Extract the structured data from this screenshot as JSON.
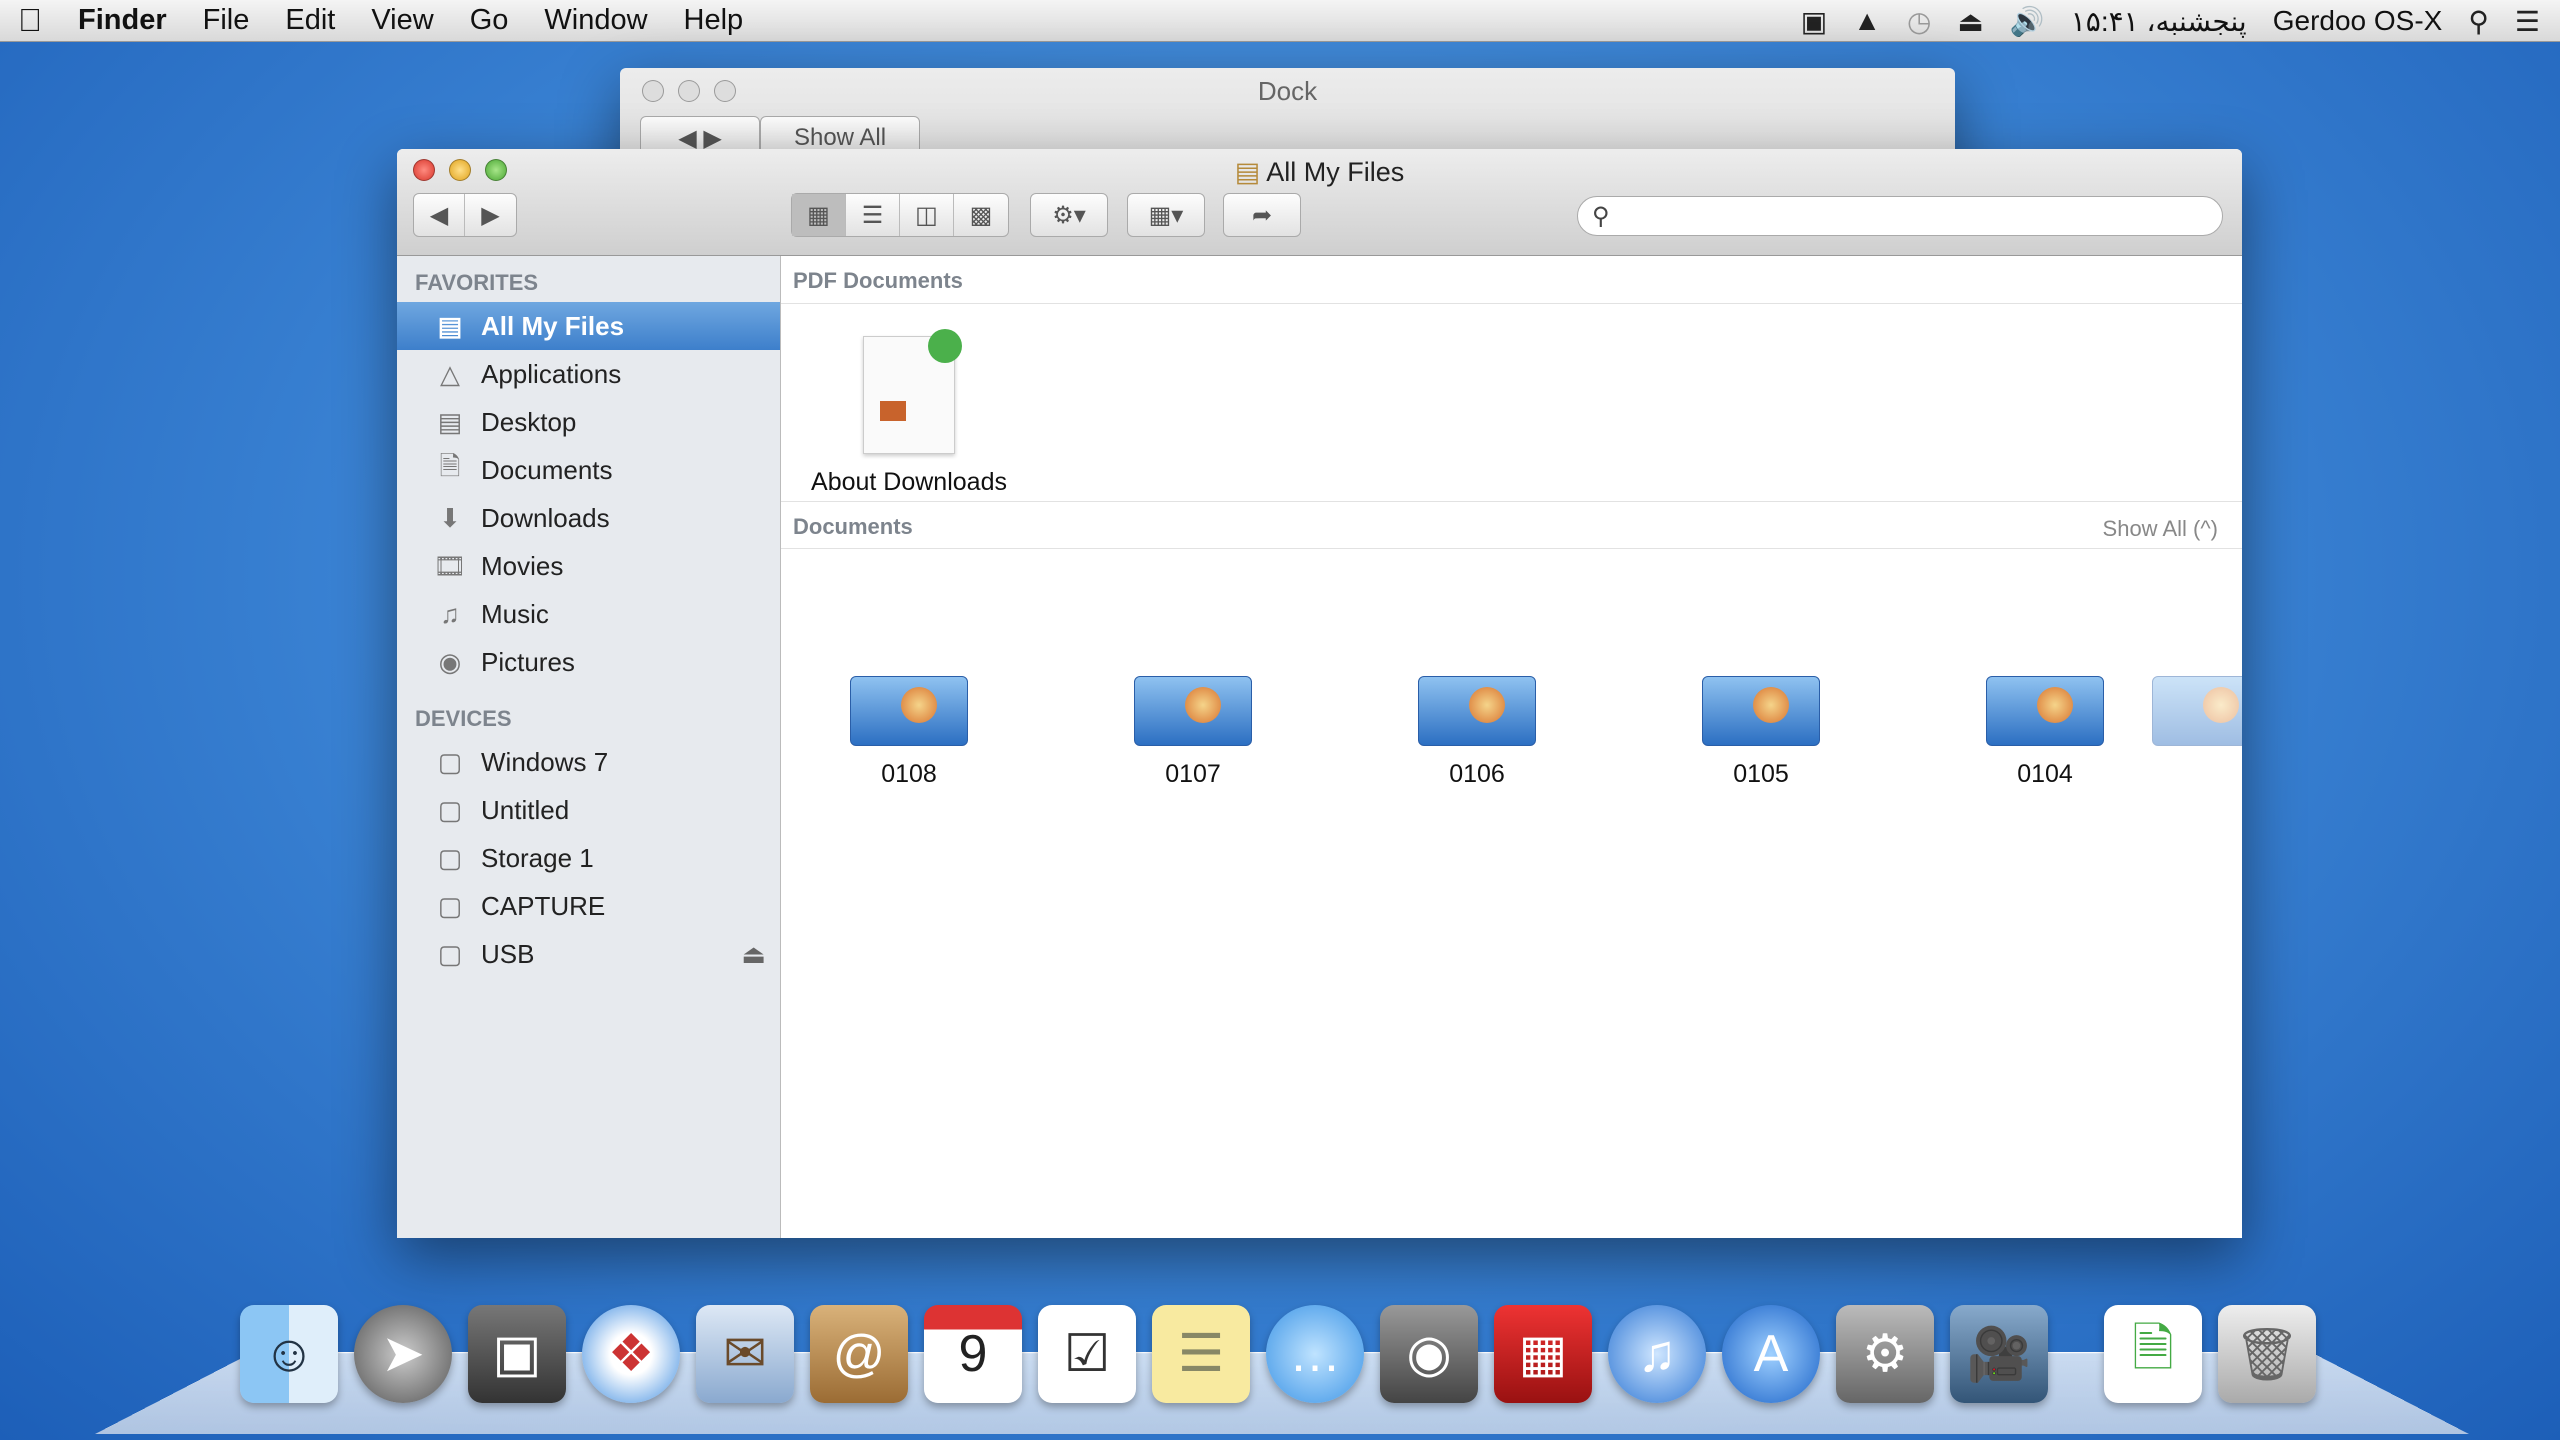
{
  "menubar": {
    "app": "Finder",
    "items": [
      "File",
      "Edit",
      "View",
      "Go",
      "Window",
      "Help"
    ],
    "clock": "پنجشنبه، ۱۵:۴۱",
    "user": "Gerdoo OS-X"
  },
  "dock_window": {
    "title": "Dock",
    "show_all": "Show All"
  },
  "finder": {
    "title": "All My Files",
    "search_placeholder": "",
    "sidebar": {
      "favorites_header": "FAVORITES",
      "favorites": [
        "All My Files",
        "Applications",
        "Desktop",
        "Documents",
        "Downloads",
        "Movies",
        "Music",
        "Pictures"
      ],
      "devices_header": "DEVICES",
      "devices": [
        "Windows 7",
        "Untitled",
        "Storage 1",
        "CAPTURE",
        "USB"
      ]
    },
    "sections": {
      "pdf": "PDF Documents",
      "docs": "Documents",
      "show_all": "Show All (^)"
    },
    "pdf_files": [
      "About Downloads"
    ],
    "doc_files": [
      "0108",
      "0107",
      "0106",
      "0105",
      "0104"
    ]
  },
  "colors": {
    "selection": "#3d7fcb",
    "sidebar_bg": "#e7eaee"
  },
  "dock": [
    "finder",
    "launchpad",
    "image-capture",
    "safari",
    "mail",
    "contacts",
    "calendar",
    "reminders",
    "notes",
    "messages",
    "facetime",
    "photo-booth",
    "itunes",
    "app-store",
    "system-preferences",
    "imovie",
    "document",
    "trash"
  ]
}
